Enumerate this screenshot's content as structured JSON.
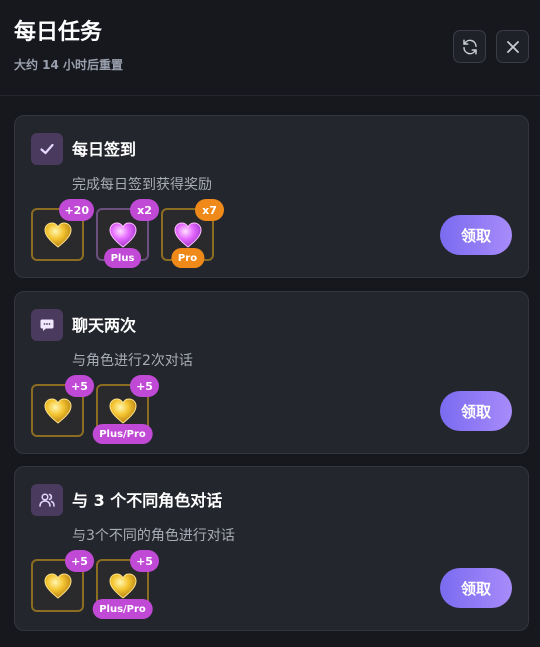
{
  "header": {
    "title": "每日任务",
    "subtitle": "大约 14 小时后重置"
  },
  "tasks": [
    {
      "name": "每日签到",
      "description": "完成每日签到获得奖励",
      "icon": "check-icon",
      "rewards": [
        {
          "badge": "+20",
          "tag": ""
        },
        {
          "badge": "x2",
          "tag": "Plus"
        },
        {
          "badge": "x7",
          "tag": "Pro"
        }
      ],
      "button": "领取"
    },
    {
      "name": "聊天两次",
      "description": "与角色进行2次对话",
      "icon": "chat-icon",
      "rewards": [
        {
          "badge": "+5",
          "tag": ""
        },
        {
          "badge": "+5",
          "tag": "Plus/Pro"
        }
      ],
      "button": "领取"
    },
    {
      "name": "与 3 个不同角色对话",
      "description": "与3个不同的角色进行对话",
      "icon": "users-icon",
      "rewards": [
        {
          "badge": "+5",
          "tag": ""
        },
        {
          "badge": "+5",
          "tag": "Plus/Pro"
        }
      ],
      "button": "领取"
    }
  ],
  "colors": {
    "background": "#16181e",
    "card": "#24262d",
    "accent_purple": "#c04ad6",
    "accent_orange": "#ef8a1a",
    "button_gradient_start": "#7a6bf0",
    "button_gradient_end": "#a78bfa"
  }
}
